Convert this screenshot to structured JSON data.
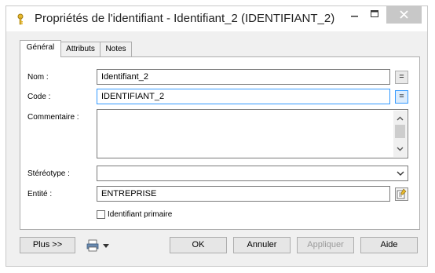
{
  "window": {
    "title": "Propriétés de l'identifiant - Identifiant_2 (IDENTIFIANT_2)"
  },
  "tabs": [
    {
      "label": "Général"
    },
    {
      "label": "Attributs"
    },
    {
      "label": "Notes"
    }
  ],
  "form": {
    "nom": {
      "label": "Nom :",
      "value": "Identifiant_2"
    },
    "code": {
      "label": "Code :",
      "value": "IDENTIFIANT_2"
    },
    "commentaire": {
      "label": "Commentaire :",
      "value": ""
    },
    "stereotype": {
      "label": "Stéréotype :",
      "value": ""
    },
    "entite": {
      "label": "Entité :",
      "value": "ENTREPRISE"
    },
    "identifiant_primaire": {
      "label": "Identifiant primaire",
      "checked": false
    },
    "equal_label": "="
  },
  "footer": {
    "plus": "Plus >>",
    "ok": "OK",
    "annuler": "Annuler",
    "appliquer": "Appliquer",
    "aide": "Aide"
  },
  "icons": [
    "key-icon",
    "minimize-icon",
    "maximize-icon",
    "close-icon",
    "scroll-up-icon",
    "scroll-down-icon",
    "dropdown-arrow-icon",
    "properties-icon",
    "printer-icon"
  ],
  "colors": {
    "focus": "#3399ff",
    "close_button": "#c8c8c8",
    "dialog_bg": "#f0f0f0"
  }
}
